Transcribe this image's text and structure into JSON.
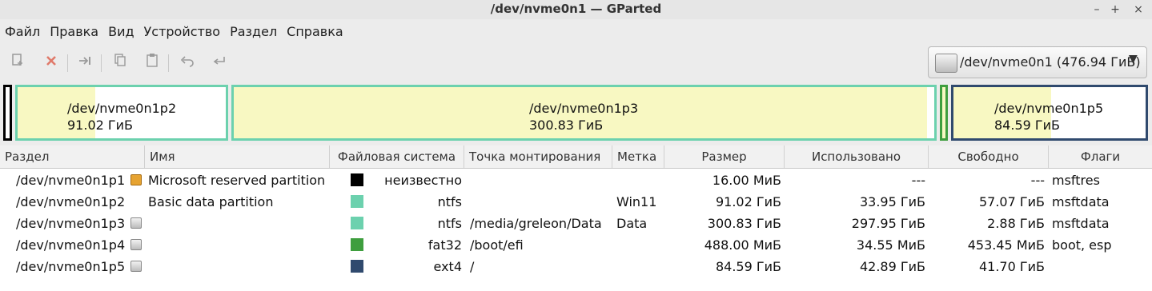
{
  "window": {
    "title": "/dev/nvme0n1 — GParted",
    "minimize": "–",
    "maximize": "+",
    "close": "×"
  },
  "menu": [
    "Файл",
    "Правка",
    "Вид",
    "Устройство",
    "Раздел",
    "Справка"
  ],
  "toolbar": {
    "new_icon": "new-partition-icon",
    "delete_icon": "delete-icon",
    "resize_icon": "resize-move-icon",
    "copy_icon": "copy-icon",
    "paste_icon": "paste-icon",
    "undo_icon": "undo-icon",
    "apply_icon": "apply-icon"
  },
  "device_selector": {
    "label": "/dev/nvme0n1 (476.94 ГиБ)"
  },
  "partition_map": [
    {
      "name": "",
      "size": ""
    },
    {
      "name": "/dev/nvme0n1p2",
      "size": "91.02 ГиБ",
      "used_fraction": 0.373
    },
    {
      "name": "/dev/nvme0n1p3",
      "size": "300.83 ГиБ",
      "used_fraction": 0.99
    },
    {
      "name": "",
      "size": ""
    },
    {
      "name": "/dev/nvme0n1p5",
      "size": "84.59 ГиБ",
      "used_fraction": 0.507
    }
  ],
  "columns": [
    "Раздел",
    "Имя",
    "Файловая система",
    "Точка монтирования",
    "Метка",
    "Размер",
    "Использовано",
    "Свободно",
    "Флаги"
  ],
  "rows": [
    {
      "partition": "/dev/nvme0n1p1",
      "name": "Microsoft reserved partition",
      "fs_color": "#000000",
      "fs": "неизвестно",
      "mount": "",
      "label": "",
      "size": "16.00 МиБ",
      "used": "---",
      "free": "---",
      "flags": "msftres",
      "icon": "warning-icon"
    },
    {
      "partition": "/dev/nvme0n1p2",
      "name": "Basic data partition",
      "fs_color": "#6cd1ae",
      "fs": "ntfs",
      "mount": "",
      "label": "Win11",
      "size": "91.02 ГиБ",
      "used": "33.95 ГиБ",
      "free": "57.07 ГиБ",
      "flags": "msftdata",
      "icon": ""
    },
    {
      "partition": "/dev/nvme0n1p3",
      "name": "",
      "fs_color": "#6cd1ae",
      "fs": "ntfs",
      "mount": "/media/greleon/Data",
      "label": "Data",
      "size": "300.83 ГиБ",
      "used": "297.95 ГиБ",
      "free": "2.88 ГиБ",
      "flags": "msftdata",
      "icon": "mounted-icon"
    },
    {
      "partition": "/dev/nvme0n1p4",
      "name": "",
      "fs_color": "#3e9e3e",
      "fs": "fat32",
      "mount": "/boot/efi",
      "label": "",
      "size": "488.00 МиБ",
      "used": "34.55 МиБ",
      "free": "453.45 МиБ",
      "flags": "boot, esp",
      "icon": "mounted-icon"
    },
    {
      "partition": "/dev/nvme0n1p5",
      "name": "",
      "fs_color": "#304a6e",
      "fs": "ext4",
      "mount": "/",
      "label": "",
      "size": "84.59 ГиБ",
      "used": "42.89 ГиБ",
      "free": "41.70 ГиБ",
      "flags": "",
      "icon": "mounted-icon"
    }
  ]
}
